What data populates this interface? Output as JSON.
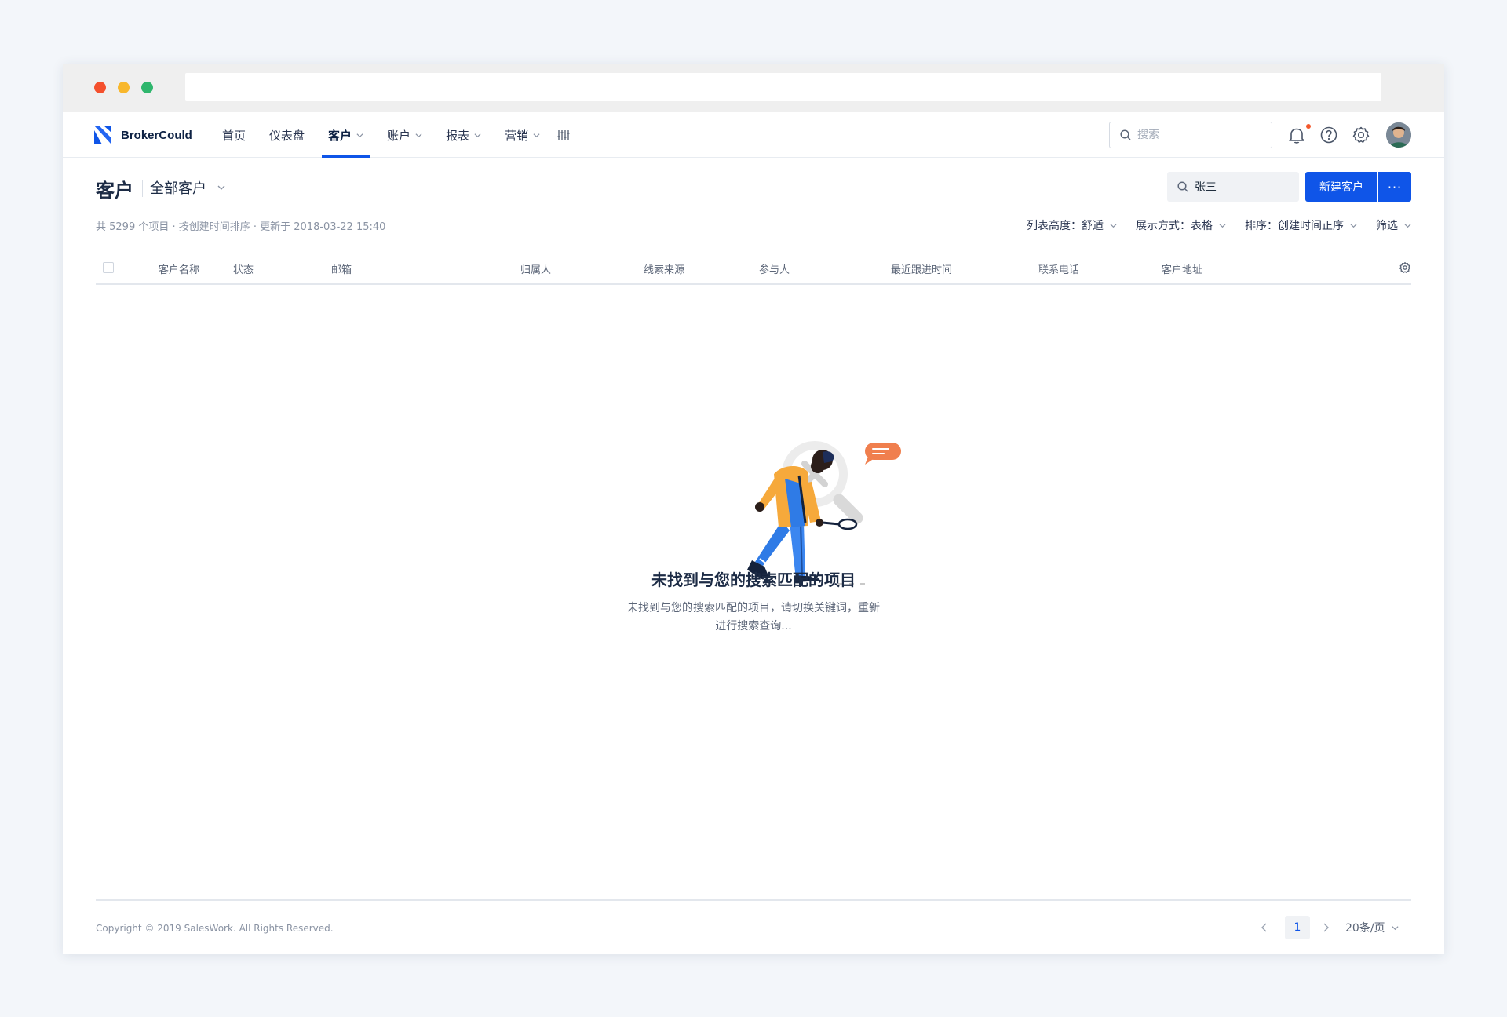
{
  "app": {
    "brand": "BrokerCould"
  },
  "nav": {
    "items": [
      {
        "label": "首页",
        "has_dropdown": false,
        "active": false
      },
      {
        "label": "仪表盘",
        "has_dropdown": false,
        "active": false
      },
      {
        "label": "客户",
        "has_dropdown": true,
        "active": true
      },
      {
        "label": "账户",
        "has_dropdown": true,
        "active": false
      },
      {
        "label": "报表",
        "has_dropdown": true,
        "active": false
      },
      {
        "label": "营销",
        "has_dropdown": true,
        "active": false
      }
    ],
    "search_placeholder": "搜索"
  },
  "page": {
    "title": "客户",
    "view": "全部客户",
    "search_value": "张三",
    "new_button": "新建客户",
    "more_button": "···",
    "meta": "共 5299 个项目 · 按创建时间排序 · 更新于 2018-03-22 15:40",
    "controls": [
      {
        "label": "列表高度：舒适"
      },
      {
        "label": "展示方式：表格"
      },
      {
        "label": "排序：创建时间正序"
      },
      {
        "label": "筛选"
      }
    ]
  },
  "table": {
    "columns": [
      "客户名称",
      "状态",
      "邮箱",
      "归属人",
      "线索来源",
      "参与人",
      "最近跟进时间",
      "联系电话",
      "客户地址"
    ],
    "rows": []
  },
  "empty_state": {
    "title": "未找到与您的搜索匹配的项目",
    "line1": "未找到与您的搜索匹配的项目，请切换关键词，重新",
    "line2": "进行搜索查询..."
  },
  "footer": {
    "copyright": "Copyright © 2019 SalesWork. All Rights Reserved.",
    "current_page": "1",
    "page_size": "20条/页"
  },
  "colors": {
    "primary": "#0f55e8",
    "background": "#f3f6fa",
    "notification_dot": "#f4582c",
    "illustration_orange": "#f6a93b",
    "illustration_blue": "#2f7be6",
    "illustration_bubble": "#f07f4e"
  },
  "icons": {
    "logo": "brokercould-logo-icon",
    "search": "search-icon",
    "notifications": "bell-icon",
    "help": "help-icon",
    "settings": "gear-icon",
    "nav_adjust": "adjust-icon",
    "dropdown": "chevron-down-icon",
    "prev": "chevron-left-icon",
    "next": "chevron-right-icon"
  }
}
